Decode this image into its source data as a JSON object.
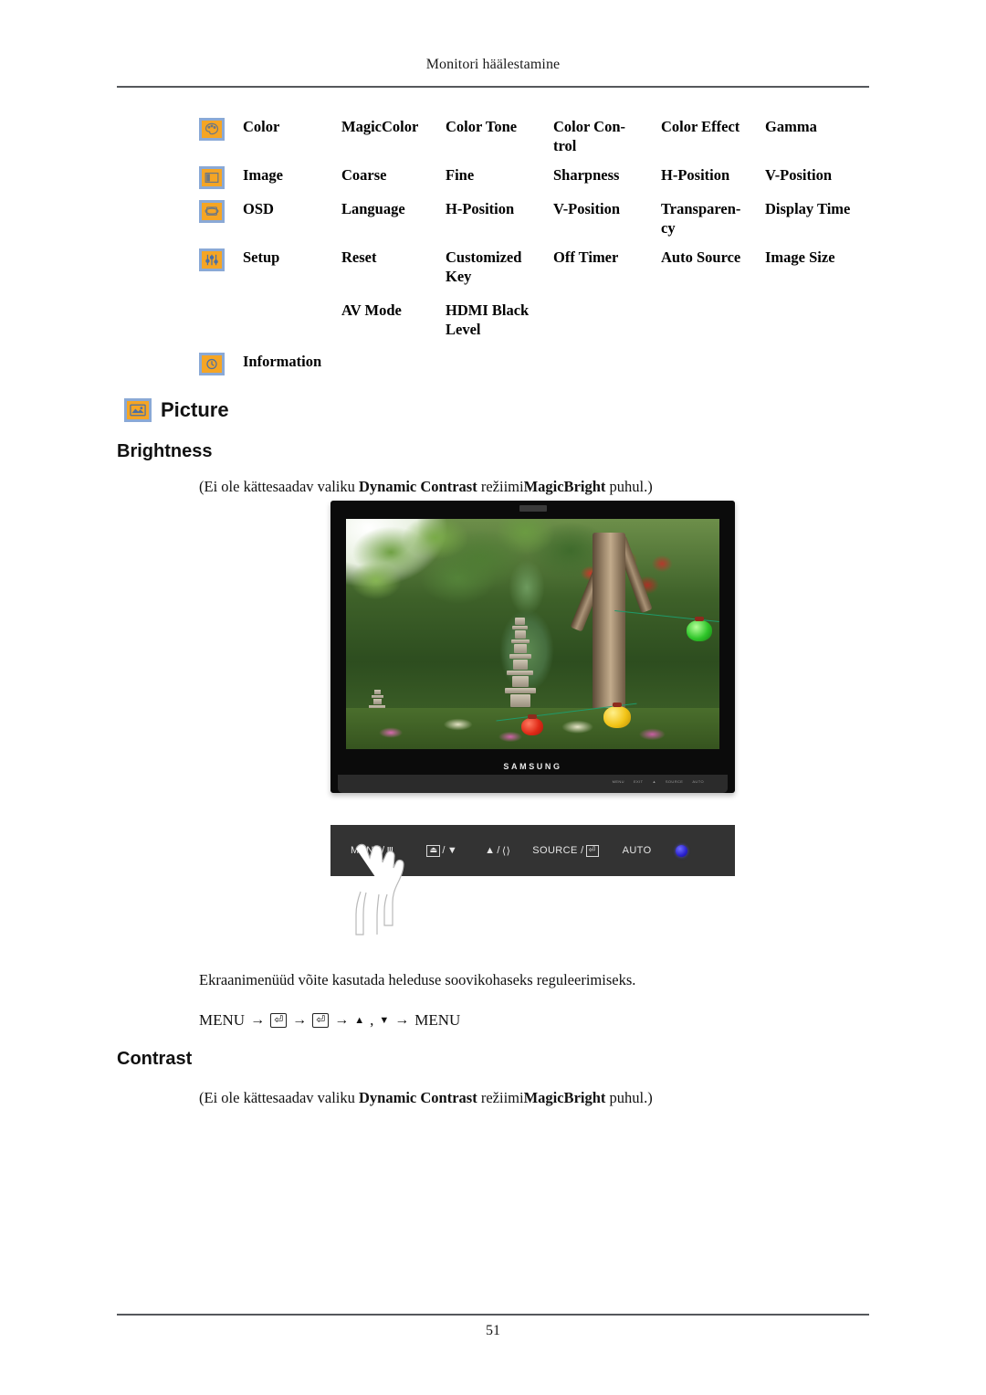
{
  "header": {
    "title": "Monitori häälestamine"
  },
  "menu_table": {
    "rows": [
      {
        "icon": "color-palette-icon",
        "category": "Color",
        "items": [
          "MagicColor",
          "Color Tone",
          "Color Con-\ntrol",
          "Color Effect",
          "Gamma"
        ]
      },
      {
        "icon": "image-frame-icon",
        "category": "Image",
        "items": [
          "Coarse",
          "Fine",
          "Sharpness",
          "H-Position",
          "V-Position"
        ]
      },
      {
        "icon": "osd-window-icon",
        "category": "OSD",
        "items": [
          "Language",
          "H-Position",
          "V-Position",
          "Transparen-\ncy",
          "Display Time"
        ]
      },
      {
        "icon": "setup-sliders-icon",
        "category": "Setup",
        "items": [
          "Reset",
          "Customized Key",
          "Off Timer",
          "Auto Source",
          "Image Size"
        ]
      },
      {
        "icon": "",
        "category": "",
        "items": [
          "AV Mode",
          "HDMI Black Level",
          "",
          "",
          ""
        ]
      },
      {
        "icon": "information-clock-icon",
        "category": "Information",
        "items": [
          "",
          "",
          "",
          "",
          ""
        ]
      }
    ]
  },
  "sections": {
    "picture": {
      "icon": "picture-icon",
      "heading": "Picture"
    },
    "brightness": {
      "heading": "Brightness",
      "note_prefix": "(Ei ole kättesaadav valiku ",
      "note_bold_1": "Dynamic Contrast",
      "note_mid": " režiimi",
      "note_bold_2": "MagicBright",
      "note_suffix": " puhul.)",
      "body": "Ekraanimenüüd võite kasutada heleduse soovikohaseks reguleerimiseks.",
      "menu_path": {
        "start": "MENU",
        "arrow": "→",
        "enter_key": "⏎",
        "up_arrow": "▲",
        "comma": ",",
        "down_arrow": "▼",
        "end": "MENU"
      }
    },
    "contrast": {
      "heading": "Contrast",
      "note_prefix": "(Ei ole kättesaadav valiku ",
      "note_bold_1": "Dynamic Contrast",
      "note_mid": " režiimi",
      "note_bold_2": "MagicBright",
      "note_suffix": " puhul.)"
    }
  },
  "monitor_figure": {
    "brand": "SAMSUNG",
    "base_labels": [
      "MENU",
      "EXIT",
      "▲",
      "SOURCE",
      "AUTO"
    ],
    "buttons": [
      {
        "name": "menu-button",
        "label": "MENU/",
        "glyph": "Ⅲ"
      },
      {
        "name": "down-button",
        "label": "/",
        "key": "⏏",
        "glyph": "▼"
      },
      {
        "name": "up-button",
        "label": "/",
        "glyph": "▲",
        "key2": "⟨⟩"
      },
      {
        "name": "source-button",
        "label": "SOURCE /",
        "key": "⏎"
      },
      {
        "name": "auto-button",
        "label": "AUTO"
      },
      {
        "name": "power-button",
        "label": ""
      }
    ]
  },
  "footer": {
    "page_number": "51"
  },
  "colors": {
    "icon_fill": "#f5a524",
    "icon_border": "#8aa9d6",
    "rule": "#55585c",
    "panel_bg": "#333333",
    "power_led": "#2a21cf"
  }
}
